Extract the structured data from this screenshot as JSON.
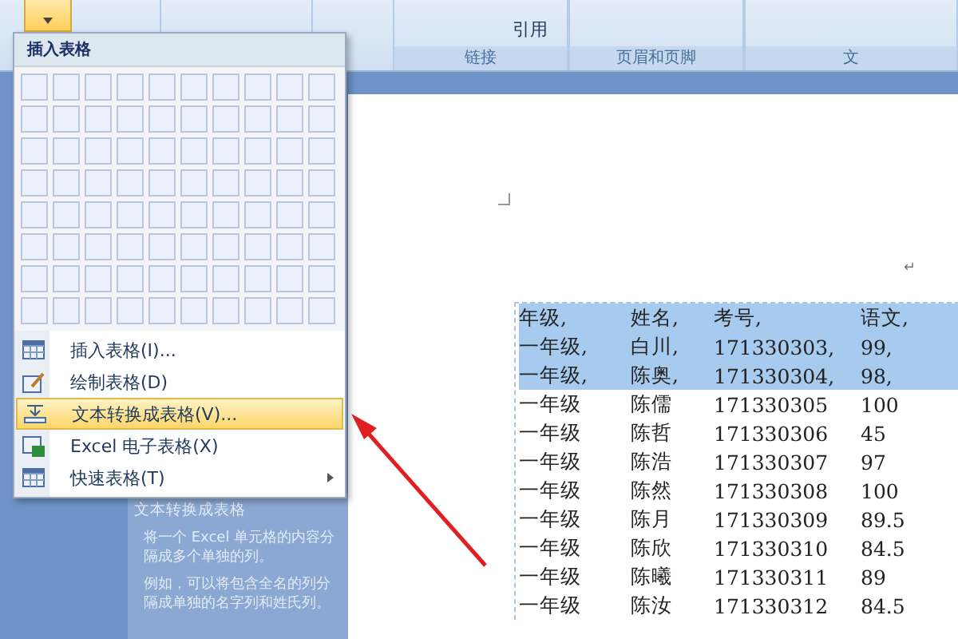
{
  "ribbon": {
    "groups": [
      {
        "label": "链接",
        "buttons": [
          {
            "label": "引用"
          }
        ]
      },
      {
        "label": "页眉和页脚"
      },
      {
        "label": "文"
      }
    ]
  },
  "table_menu": {
    "title": "插入表格",
    "items": [
      {
        "kind": "table",
        "label": "插入表格(I)...",
        "selected": false,
        "submenu": false
      },
      {
        "kind": "pencil",
        "label": "绘制表格(D)",
        "selected": false,
        "submenu": false
      },
      {
        "kind": "convert",
        "label": "文本转换成表格(V)...",
        "selected": true,
        "submenu": false
      },
      {
        "kind": "spreadsheet",
        "label": "Excel 电子表格(X)",
        "selected": false,
        "submenu": false
      },
      {
        "kind": "table",
        "label": "快速表格(T)",
        "selected": false,
        "submenu": true
      }
    ]
  },
  "tooltip": {
    "title": "文本转换成表格",
    "paragraphs": [
      "将一个 Excel 单元格的内容分隔成多个单独的列。",
      "例如，可以将包含全名的列分隔成单独的名字列和姓氏列。"
    ]
  },
  "document": {
    "paragraph_mark": "↵",
    "rows": [
      {
        "cells": [
          "年级,",
          "姓名,",
          "考号,",
          "语文,"
        ],
        "selected": true
      },
      {
        "cells": [
          "一年级,",
          "白川,",
          "171330303,",
          "99,"
        ],
        "selected": true
      },
      {
        "cells": [
          "一年级,",
          "陈奥,",
          "171330304,",
          "98,"
        ],
        "selected": true
      },
      {
        "cells": [
          "一年级",
          "陈儒",
          "171330305",
          "100"
        ],
        "selected": false
      },
      {
        "cells": [
          "一年级",
          "陈哲",
          "171330306",
          "45"
        ],
        "selected": false
      },
      {
        "cells": [
          "一年级",
          "陈浩",
          "171330307",
          "97"
        ],
        "selected": false
      },
      {
        "cells": [
          "一年级",
          "陈然",
          "171330308",
          "100"
        ],
        "selected": false
      },
      {
        "cells": [
          "一年级",
          "陈月",
          "171330309",
          "89.5"
        ],
        "selected": false
      },
      {
        "cells": [
          "一年级",
          "陈欣",
          "171330310",
          "84.5"
        ],
        "selected": false
      },
      {
        "cells": [
          "一年级",
          "陈曦",
          "171330311",
          "89"
        ],
        "selected": false
      },
      {
        "cells": [
          "一年级",
          "陈汝",
          "171330312",
          "84.5"
        ],
        "selected": false
      }
    ]
  }
}
